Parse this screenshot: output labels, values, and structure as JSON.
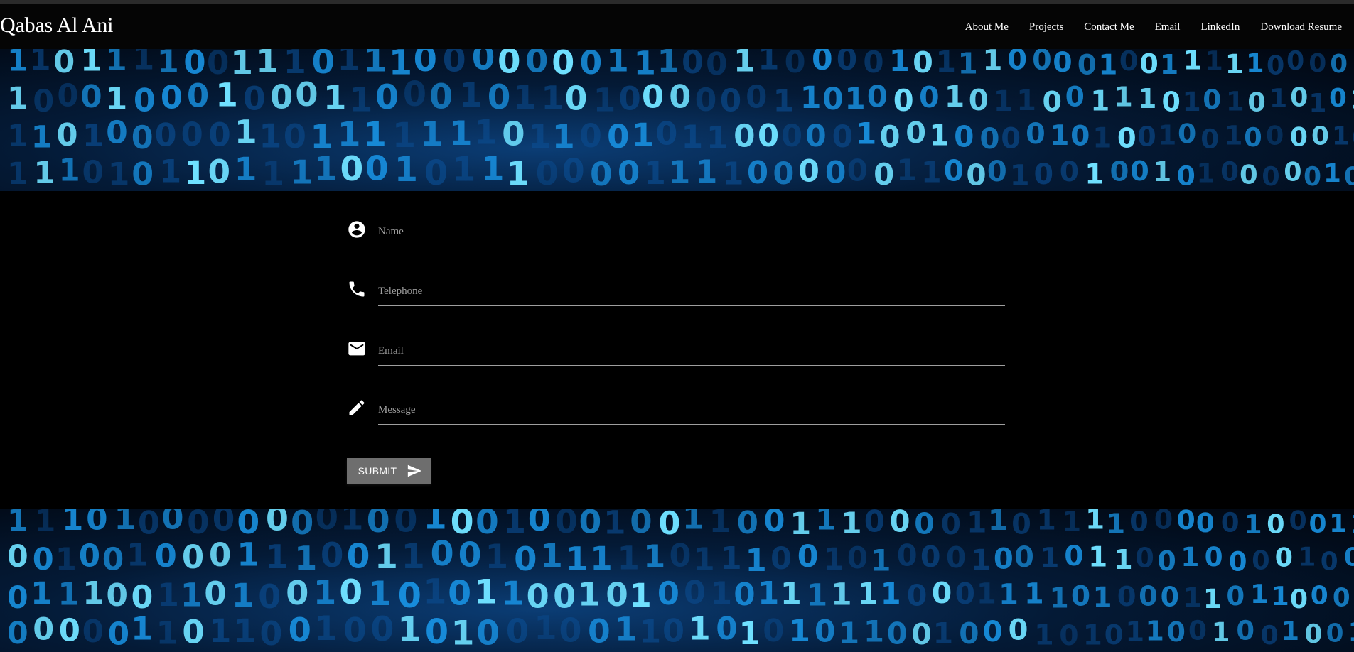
{
  "brand": {
    "name": "Qabas Al Ani"
  },
  "nav": {
    "items": [
      {
        "label": "About Me"
      },
      {
        "label": "Projects"
      },
      {
        "label": "Contact Me"
      },
      {
        "label": "Email"
      },
      {
        "label": "LinkedIn"
      },
      {
        "label": "Download Resume"
      }
    ]
  },
  "contact_form": {
    "fields": [
      {
        "icon": "account-circle-icon",
        "placeholder": "Name",
        "value": ""
      },
      {
        "icon": "phone-icon",
        "placeholder": "Telephone",
        "value": ""
      },
      {
        "icon": "email-icon",
        "placeholder": "Email",
        "value": ""
      },
      {
        "icon": "pencil-icon",
        "placeholder": "Message",
        "value": ""
      }
    ],
    "submit": {
      "label": "SUBMIT",
      "icon": "send-icon"
    }
  },
  "colors": {
    "background": "#000000",
    "navbar": "#050505",
    "button": "#6e6e6e",
    "underline": "#9e9e9e",
    "banner_glow": "#1fa8ff"
  }
}
